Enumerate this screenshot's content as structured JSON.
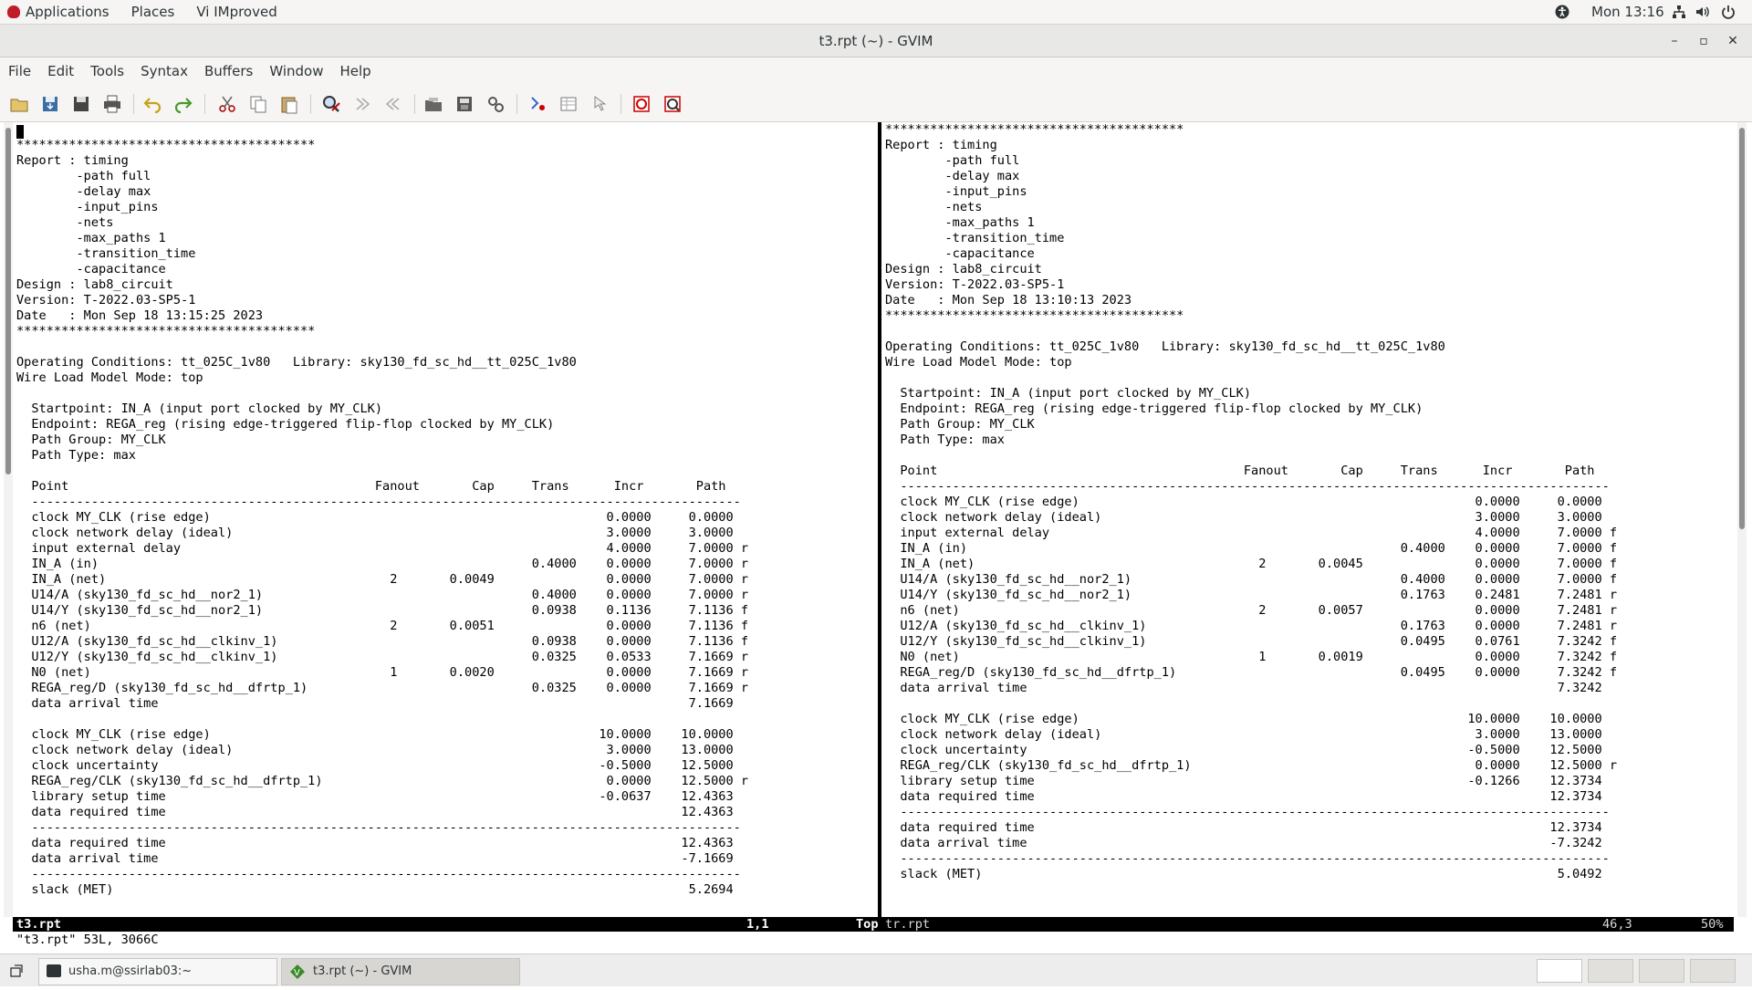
{
  "top_panel": {
    "menus": [
      "Applications",
      "Places",
      "Vi IMproved"
    ],
    "clock": "Mon 13:16",
    "tray_icons": [
      "accessibility-icon",
      "network-icon",
      "volume-icon",
      "power-icon"
    ]
  },
  "window": {
    "title": "t3.rpt (~) - GVIM",
    "controls": {
      "minimize": "–",
      "maximize": "▫",
      "close": "✕"
    }
  },
  "menubar": {
    "items": [
      "File",
      "Edit",
      "Tools",
      "Syntax",
      "Buffers",
      "Window",
      "Help"
    ]
  },
  "toolbar": {
    "icons": [
      "open-icon",
      "save-icon",
      "save-all-icon",
      "print-icon",
      "undo-icon",
      "redo-icon",
      "cut-icon",
      "copy-icon",
      "paste-icon",
      "find-replace-icon",
      "find-next-icon",
      "find-prev-icon",
      "load-session-icon",
      "save-session-icon",
      "run-script-icon",
      "make-icon",
      "shell-icon",
      "tags-icon",
      "help-icon",
      "find-help-icon"
    ]
  },
  "left_pane": {
    "text": "\n****************************************\nReport : timing\n        -path full\n        -delay max\n        -input_pins\n        -nets\n        -max_paths 1\n        -transition_time\n        -capacitance\nDesign : lab8_circuit\nVersion: T-2022.03-SP5-1\nDate   : Mon Sep 18 13:15:25 2023\n****************************************\n\nOperating Conditions: tt_025C_1v80   Library: sky130_fd_sc_hd__tt_025C_1v80\nWire Load Model Mode: top\n\n  Startpoint: IN_A (input port clocked by MY_CLK)\n  Endpoint: REGA_reg (rising edge-triggered flip-flop clocked by MY_CLK)\n  Path Group: MY_CLK\n  Path Type: max\n\n  Point                                         Fanout       Cap     Trans      Incr       Path\n  -----------------------------------------------------------------------------------------------\n  clock MY_CLK (rise edge)                                                     0.0000     0.0000\n  clock network delay (ideal)                                                  3.0000     3.0000\n  input external delay                                                         4.0000     7.0000 r\n  IN_A (in)                                                          0.4000    0.0000     7.0000 r\n  IN_A (net)                                      2       0.0049               0.0000     7.0000 r\n  U14/A (sky130_fd_sc_hd__nor2_1)                                    0.4000    0.0000     7.0000 r\n  U14/Y (sky130_fd_sc_hd__nor2_1)                                    0.0938    0.1136     7.1136 f\n  n6 (net)                                        2       0.0051               0.0000     7.1136 f\n  U12/A (sky130_fd_sc_hd__clkinv_1)                                  0.0938    0.0000     7.1136 f\n  U12/Y (sky130_fd_sc_hd__clkinv_1)                                  0.0325    0.0533     7.1669 r\n  N0 (net)                                        1       0.0020               0.0000     7.1669 r\n  REGA_reg/D (sky130_fd_sc_hd__dfrtp_1)                              0.0325    0.0000     7.1669 r\n  data arrival time                                                                       7.1669\n\n  clock MY_CLK (rise edge)                                                    10.0000    10.0000\n  clock network delay (ideal)                                                  3.0000    13.0000\n  clock uncertainty                                                           -0.5000    12.5000\n  REGA_reg/CLK (sky130_fd_sc_hd__dfrtp_1)                                      0.0000    12.5000 r\n  library setup time                                                          -0.0637    12.4363\n  data required time                                                                     12.4363\n  -----------------------------------------------------------------------------------------------\n  data required time                                                                     12.4363\n  data arrival time                                                                      -7.1669\n  -----------------------------------------------------------------------------------------------\n  slack (MET)                                                                             5.2694",
    "status_name": "t3.rpt",
    "status_pos": "1,1",
    "status_scroll": "Top"
  },
  "right_pane": {
    "text": "****************************************\nReport : timing\n        -path full\n        -delay max\n        -input_pins\n        -nets\n        -max_paths 1\n        -transition_time\n        -capacitance\nDesign : lab8_circuit\nVersion: T-2022.03-SP5-1\nDate   : Mon Sep 18 13:10:13 2023\n****************************************\n\nOperating Conditions: tt_025C_1v80   Library: sky130_fd_sc_hd__tt_025C_1v80\nWire Load Model Mode: top\n\n  Startpoint: IN_A (input port clocked by MY_CLK)\n  Endpoint: REGA_reg (rising edge-triggered flip-flop clocked by MY_CLK)\n  Path Group: MY_CLK\n  Path Type: max\n\n  Point                                         Fanout       Cap     Trans      Incr       Path\n  -----------------------------------------------------------------------------------------------\n  clock MY_CLK (rise edge)                                                     0.0000     0.0000\n  clock network delay (ideal)                                                  3.0000     3.0000\n  input external delay                                                         4.0000     7.0000 f\n  IN_A (in)                                                          0.4000    0.0000     7.0000 f\n  IN_A (net)                                      2       0.0045               0.0000     7.0000 f\n  U14/A (sky130_fd_sc_hd__nor2_1)                                    0.4000    0.0000     7.0000 f\n  U14/Y (sky130_fd_sc_hd__nor2_1)                                    0.1763    0.2481     7.2481 r\n  n6 (net)                                        2       0.0057               0.0000     7.2481 r\n  U12/A (sky130_fd_sc_hd__clkinv_1)                                  0.1763    0.0000     7.2481 r\n  U12/Y (sky130_fd_sc_hd__clkinv_1)                                  0.0495    0.0761     7.3242 f\n  N0 (net)                                        1       0.0019               0.0000     7.3242 f\n  REGA_reg/D (sky130_fd_sc_hd__dfrtp_1)                              0.0495    0.0000     7.3242 f\n  data arrival time                                                                       7.3242\n\n  clock MY_CLK (rise edge)                                                    10.0000    10.0000\n  clock network delay (ideal)                                                  3.0000    13.0000\n  clock uncertainty                                                           -0.5000    12.5000\n  REGA_reg/CLK (sky130_fd_sc_hd__dfrtp_1)                                      0.0000    12.5000 r\n  library setup time                                                          -0.1266    12.3734\n  data required time                                                                     12.3734\n  -----------------------------------------------------------------------------------------------\n  data required time                                                                     12.3734\n  data arrival time                                                                      -7.3242\n  -----------------------------------------------------------------------------------------------\n  slack (MET)                                                                             5.0492",
    "status_name": "tr.rpt",
    "status_pos": "46,3",
    "status_scroll": "50%"
  },
  "cmdline": "\"t3.rpt\" 53L, 3066C",
  "taskbar": {
    "tasks": [
      "usha.m@ssirlab03:~",
      "t3.rpt (~) - GVIM"
    ]
  }
}
